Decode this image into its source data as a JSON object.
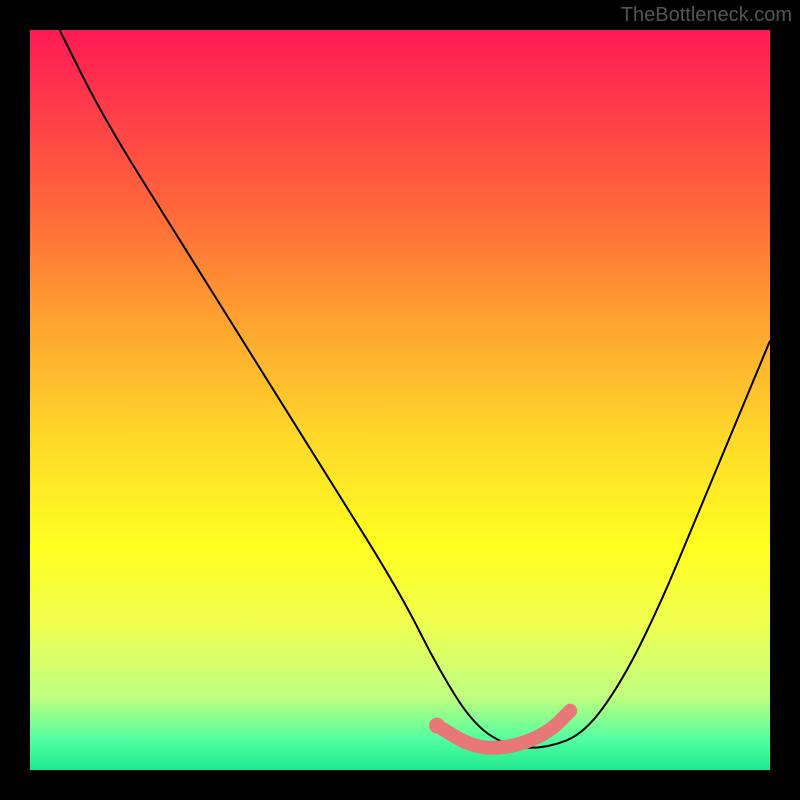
{
  "watermark": "TheBottleneck.com",
  "chart_data": {
    "type": "line",
    "title": "",
    "xlabel": "",
    "ylabel": "",
    "xlim": [
      0,
      100
    ],
    "ylim": [
      0,
      100
    ],
    "series": [
      {
        "name": "main-curve",
        "x": [
          4,
          10,
          20,
          30,
          40,
          50,
          55,
          60,
          65,
          70,
          75,
          80,
          85,
          90,
          95,
          100
        ],
        "y": [
          100,
          88,
          72,
          56,
          40,
          24,
          14,
          6,
          3,
          3,
          5,
          12,
          22,
          34,
          46,
          58
        ]
      },
      {
        "name": "highlight-segment",
        "x": [
          55,
          60,
          65,
          70,
          73
        ],
        "y": [
          6,
          3,
          3,
          5,
          8
        ]
      }
    ],
    "gradient_stops": [
      {
        "pos": 0,
        "color": "#ff1a55"
      },
      {
        "pos": 25,
        "color": "#ff6a3a"
      },
      {
        "pos": 55,
        "color": "#ffd82a"
      },
      {
        "pos": 80,
        "color": "#f0ff50"
      },
      {
        "pos": 100,
        "color": "#20e890"
      }
    ]
  }
}
